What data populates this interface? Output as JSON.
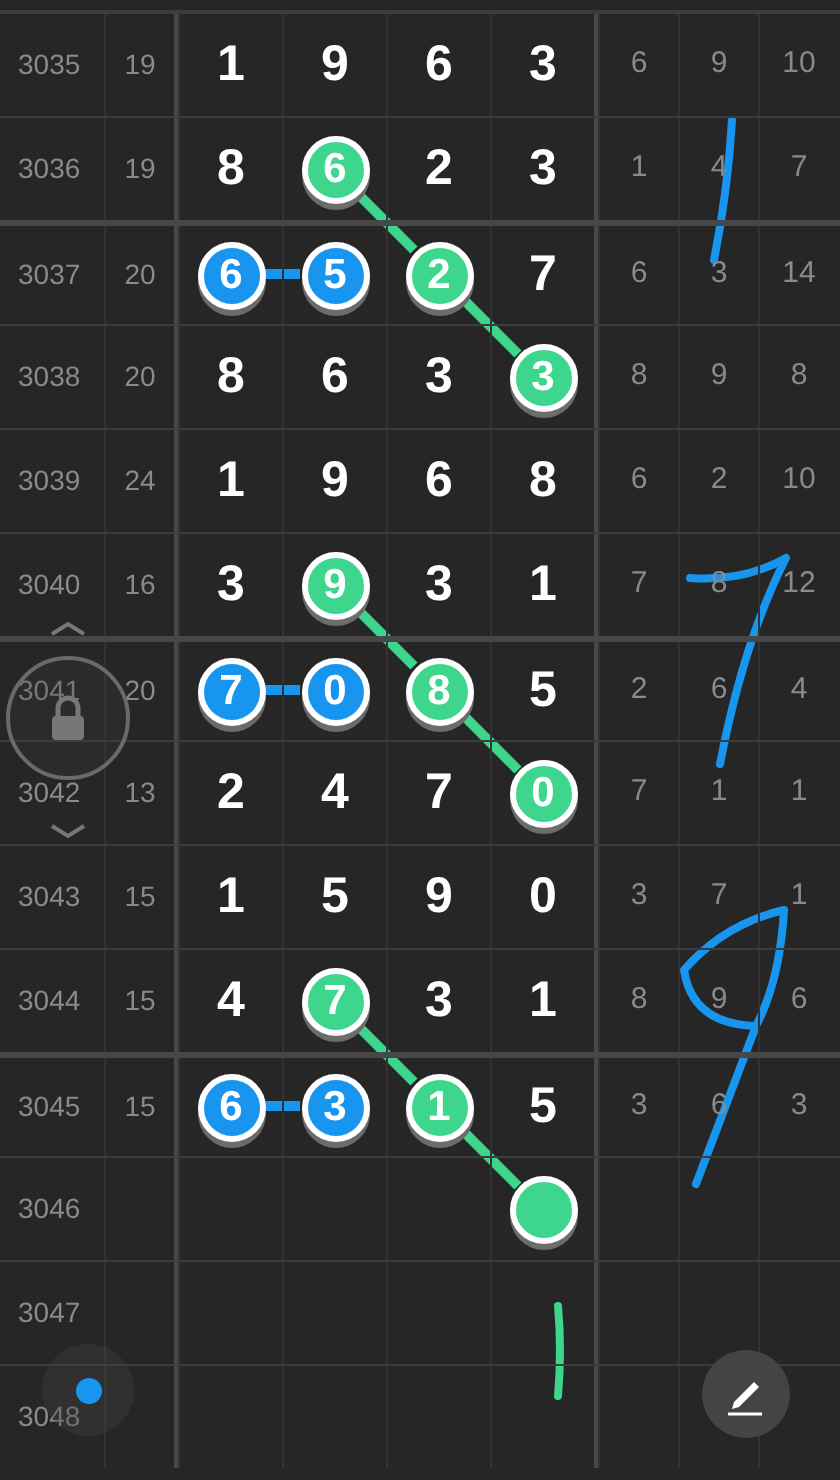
{
  "rows": [
    {
      "issue": "3035",
      "sum": "19",
      "cells": [
        {
          "digit": "1"
        },
        {
          "digit": "9"
        },
        {
          "digit": "6"
        },
        {
          "digit": "3"
        }
      ],
      "stats": [
        "6",
        "9",
        "10"
      ],
      "divider_above": false
    },
    {
      "issue": "3036",
      "sum": "19",
      "cells": [
        {
          "digit": "8"
        },
        {
          "digit": "6",
          "color": "#3dd68c"
        },
        {
          "digit": "2"
        },
        {
          "digit": "3"
        }
      ],
      "stats": [
        "1",
        "4",
        "7"
      ],
      "divider_above": false
    },
    {
      "issue": "3037",
      "sum": "20",
      "cells": [
        {
          "digit": "6",
          "color": "#1895ee"
        },
        {
          "digit": "5",
          "color": "#1895ee"
        },
        {
          "digit": "2",
          "color": "#3dd68c"
        },
        {
          "digit": "7"
        }
      ],
      "stats": [
        "6",
        "3",
        "14"
      ],
      "divider_above": true
    },
    {
      "issue": "3038",
      "sum": "20",
      "cells": [
        {
          "digit": "8"
        },
        {
          "digit": "6"
        },
        {
          "digit": "3"
        },
        {
          "digit": "3",
          "color": "#3dd68c"
        }
      ],
      "stats": [
        "8",
        "9",
        "8"
      ],
      "divider_above": false
    },
    {
      "issue": "3039",
      "sum": "24",
      "cells": [
        {
          "digit": "1"
        },
        {
          "digit": "9"
        },
        {
          "digit": "6"
        },
        {
          "digit": "8"
        }
      ],
      "stats": [
        "6",
        "2",
        "10"
      ],
      "divider_above": false
    },
    {
      "issue": "3040",
      "sum": "16",
      "cells": [
        {
          "digit": "3"
        },
        {
          "digit": "9",
          "color": "#3dd68c"
        },
        {
          "digit": "3"
        },
        {
          "digit": "1"
        }
      ],
      "stats": [
        "7",
        "8",
        "12"
      ],
      "divider_above": false
    },
    {
      "issue": "3041",
      "sum": "20",
      "cells": [
        {
          "digit": "7",
          "color": "#1895ee"
        },
        {
          "digit": "0",
          "color": "#1895ee"
        },
        {
          "digit": "8",
          "color": "#3dd68c"
        },
        {
          "digit": "5"
        }
      ],
      "stats": [
        "2",
        "6",
        "4"
      ],
      "divider_above": true
    },
    {
      "issue": "3042",
      "sum": "13",
      "cells": [
        {
          "digit": "2"
        },
        {
          "digit": "4"
        },
        {
          "digit": "7"
        },
        {
          "digit": "0",
          "color": "#3dd68c"
        }
      ],
      "stats": [
        "7",
        "1",
        "1"
      ],
      "divider_above": false
    },
    {
      "issue": "3043",
      "sum": "15",
      "cells": [
        {
          "digit": "1"
        },
        {
          "digit": "5"
        },
        {
          "digit": "9"
        },
        {
          "digit": "0"
        }
      ],
      "stats": [
        "3",
        "7",
        "1"
      ],
      "divider_above": false
    },
    {
      "issue": "3044",
      "sum": "15",
      "cells": [
        {
          "digit": "4"
        },
        {
          "digit": "7",
          "color": "#3dd68c"
        },
        {
          "digit": "3"
        },
        {
          "digit": "1"
        }
      ],
      "stats": [
        "8",
        "9",
        "6"
      ],
      "divider_above": false
    },
    {
      "issue": "3045",
      "sum": "15",
      "cells": [
        {
          "digit": "6",
          "color": "#1895ee"
        },
        {
          "digit": "3",
          "color": "#1895ee"
        },
        {
          "digit": "1",
          "color": "#3dd68c"
        },
        {
          "digit": "5"
        }
      ],
      "stats": [
        "3",
        "6",
        "3"
      ],
      "divider_above": true
    },
    {
      "issue": "3046",
      "cells": [
        {},
        {},
        {},
        {
          "color": "#3dd68c"
        }
      ],
      "divider_above": false
    },
    {
      "issue": "3047",
      "divider_above": false
    },
    {
      "issue": "3048",
      "divider_above": false
    }
  ]
}
